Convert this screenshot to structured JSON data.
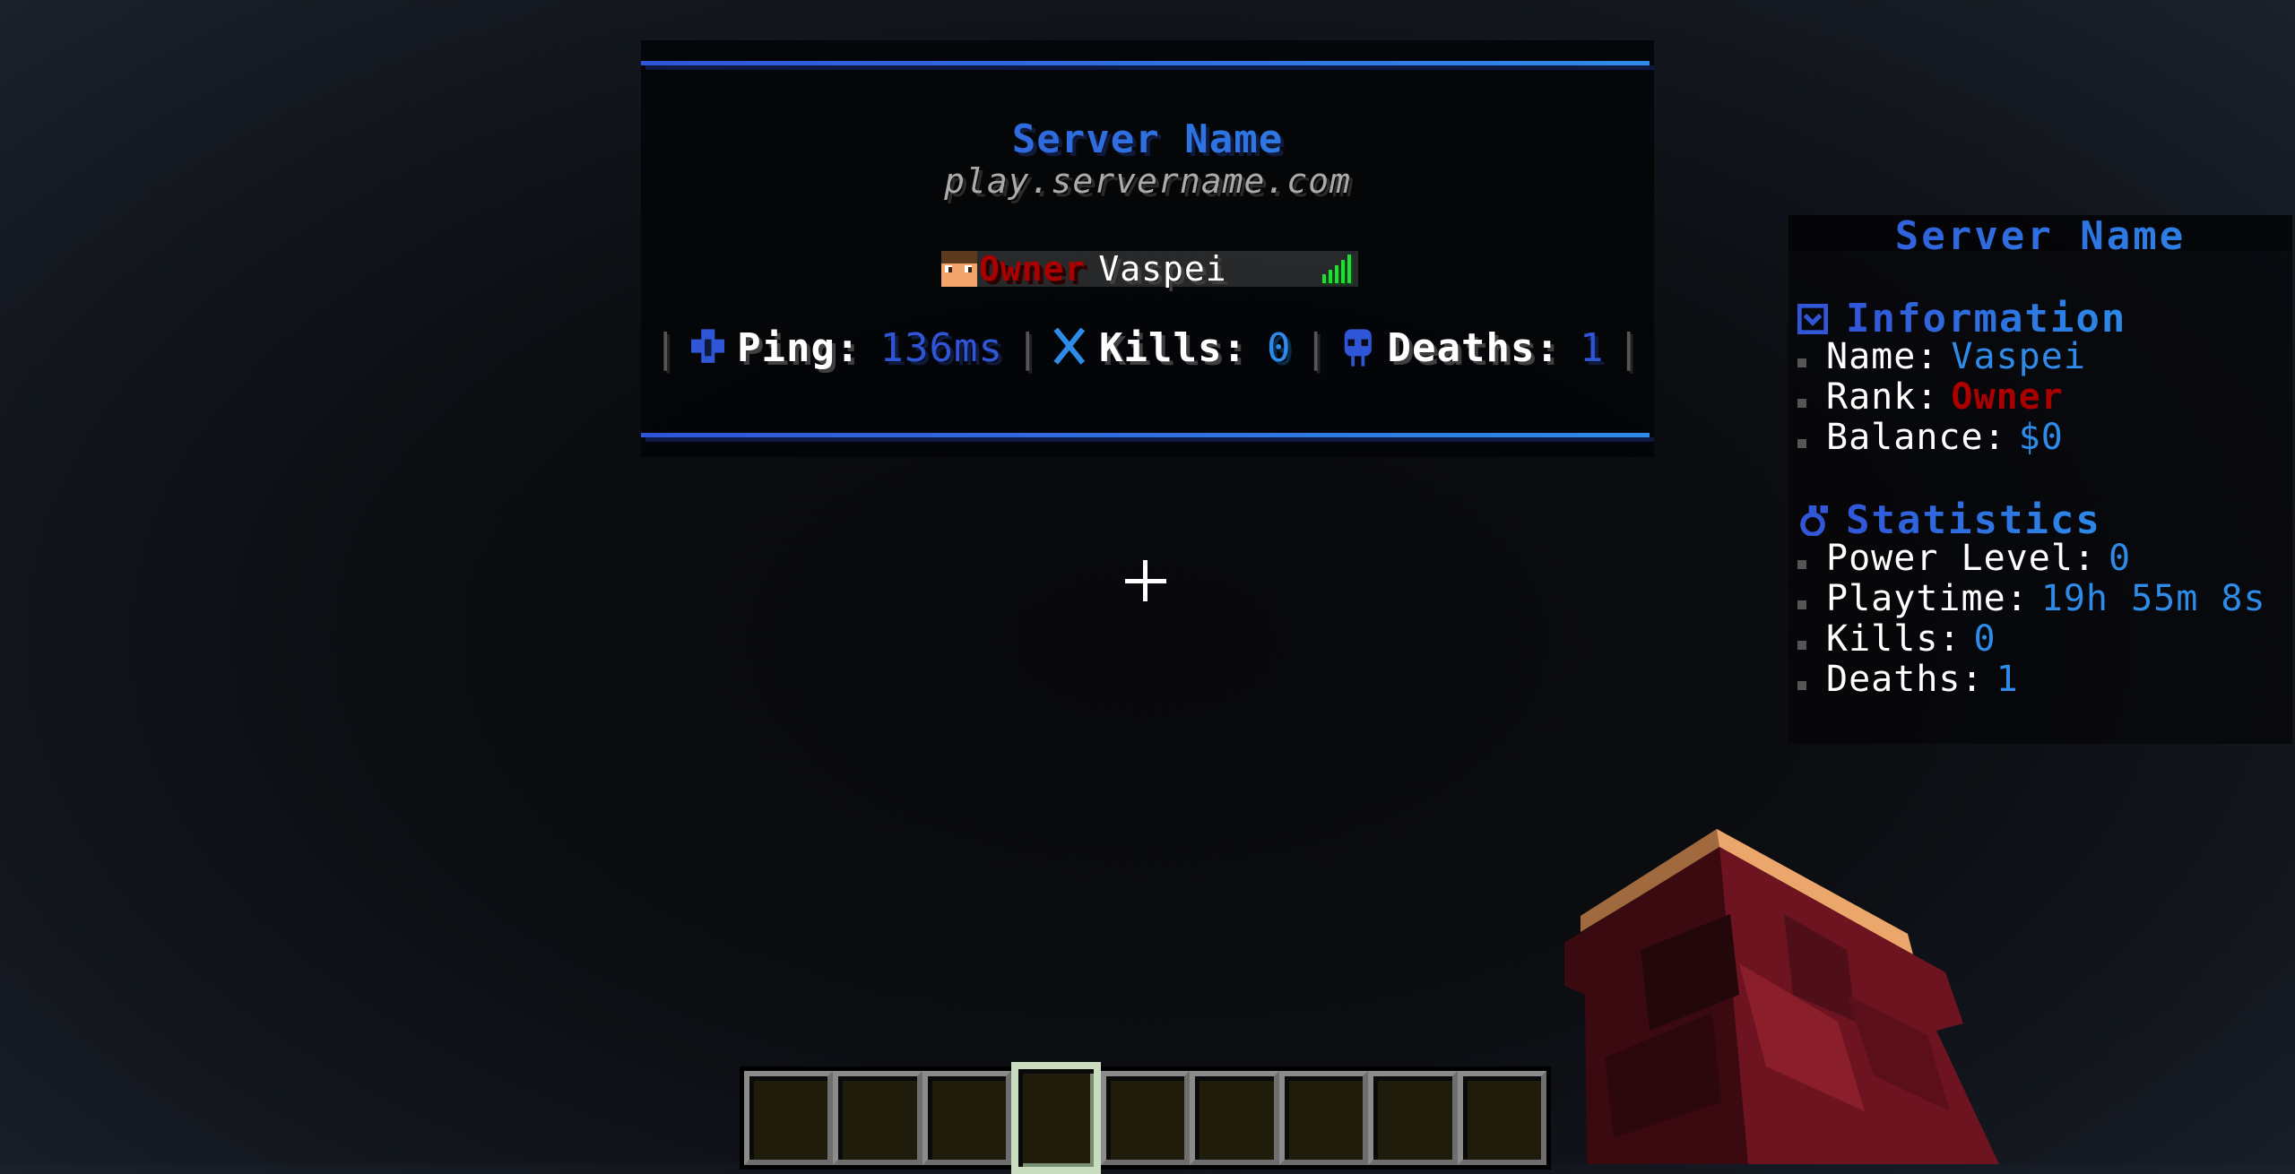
{
  "tablist": {
    "header_title": "Server Name",
    "header_address": "play.servername.com",
    "player_entry": {
      "rank": "Owner",
      "name": "Vaspei",
      "head_icon": "player-head-icon",
      "latency_icon": "signal-bars-icon",
      "latency_bars": 5
    },
    "stats": [
      {
        "icon": "ping-icon",
        "label": "Ping:",
        "value": "136ms"
      },
      {
        "icon": "swords-icon",
        "label": "Kills:",
        "value": "0"
      },
      {
        "icon": "skull-icon",
        "label": "Deaths:",
        "value": "1"
      }
    ],
    "separator": "|"
  },
  "sidebar": {
    "title": "Server Name",
    "sections": [
      {
        "icon": "envelope-icon",
        "heading": "Information",
        "lines": [
          {
            "label": "Name:",
            "value": "Vaspei"
          },
          {
            "label": "Rank:",
            "value": "Owner"
          },
          {
            "label": "Balance:",
            "value": "$0"
          }
        ]
      },
      {
        "icon": "flame-icon",
        "heading": "Statistics",
        "lines": [
          {
            "label": "Power Level:",
            "value": "0"
          },
          {
            "label": "Playtime:",
            "value": "19h 55m 8s"
          },
          {
            "label": "Kills:",
            "value": "0"
          },
          {
            "label": "Deaths:",
            "value": "1"
          }
        ]
      }
    ]
  },
  "hotbar": {
    "slot_count": 9,
    "selected_slot": 4
  },
  "colors": {
    "accent_blue": "#3156d8",
    "accent_cyan": "#2e8be8",
    "rank_red": "#aa0000",
    "latency_green": "#22dd33"
  }
}
